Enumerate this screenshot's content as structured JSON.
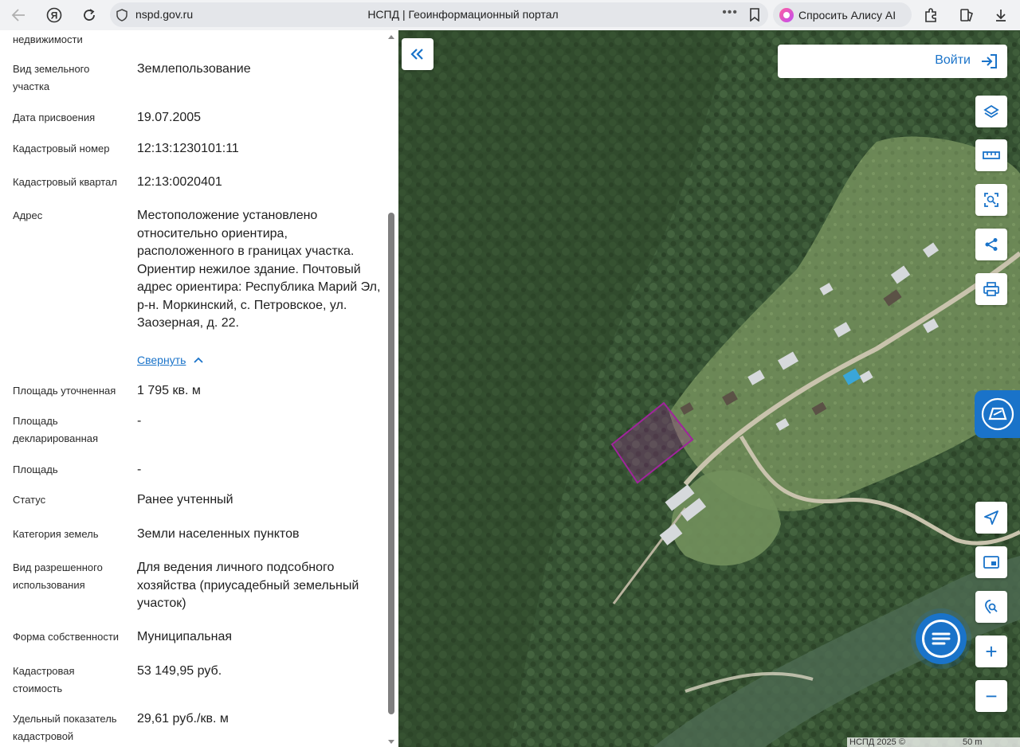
{
  "browser": {
    "url_domain": "nspd.gov.ru",
    "tab_title": "НСПД | Геоинформационный портал",
    "alice_label": "Спросить Алису AI",
    "more_label": "•••"
  },
  "panel": {
    "top_cut_label": "недвижимости",
    "rows": [
      {
        "label": "Вид земельного участка",
        "value": "Землепользование"
      },
      {
        "label": "Дата присвоения",
        "value": "19.07.2005"
      },
      {
        "label": "Кадастровый номер",
        "value": "12:13:1230101:11"
      },
      {
        "label": "Кадастровый квартал",
        "value": "12:13:0020401"
      },
      {
        "label": "Адрес",
        "value": "Местоположение установлено относительно ориентира, расположенного в границах участка. Ориентир нежилое здание. Почтовый адрес ориентира: Республика Марий Эл, р-н. Моркинский, с. Петровское, ул. Заозерная, д. 22."
      },
      {
        "label": "Площадь уточненная",
        "value": "1 795 кв. м"
      },
      {
        "label": "Площадь декларированная",
        "value": "-"
      },
      {
        "label": "Площадь",
        "value": "-"
      },
      {
        "label": "Статус",
        "value": "Ранее учтенный"
      },
      {
        "label": "Категория земель",
        "value": "Земли населенных пунктов"
      },
      {
        "label": "Вид разрешенного использования",
        "value": "Для ведения личного подсобного хозяйства (приусадебный земельный участок)"
      },
      {
        "label": "Форма собственности",
        "value": "Муниципальная"
      },
      {
        "label": "Кадастровая стоимость",
        "value": "53 149,95 руб."
      },
      {
        "label": "Удельный показатель кадастровой",
        "value": "29,61 руб./кв. м"
      }
    ],
    "collapse_link": "Свернуть"
  },
  "map": {
    "login_label": "Войти",
    "tools": [
      "layers-icon",
      "ruler-icon",
      "select-area-icon",
      "share-icon",
      "print-icon"
    ],
    "nav_tools": [
      "locate-icon",
      "minimap-icon",
      "geosearch-icon",
      "zoom-in-icon",
      "zoom-out-icon"
    ],
    "zoom_in": "+",
    "zoom_out": "−",
    "attribution": "НСПД 2025 ©",
    "scale_label": "50 m",
    "parcel_color": "#a0249c"
  }
}
